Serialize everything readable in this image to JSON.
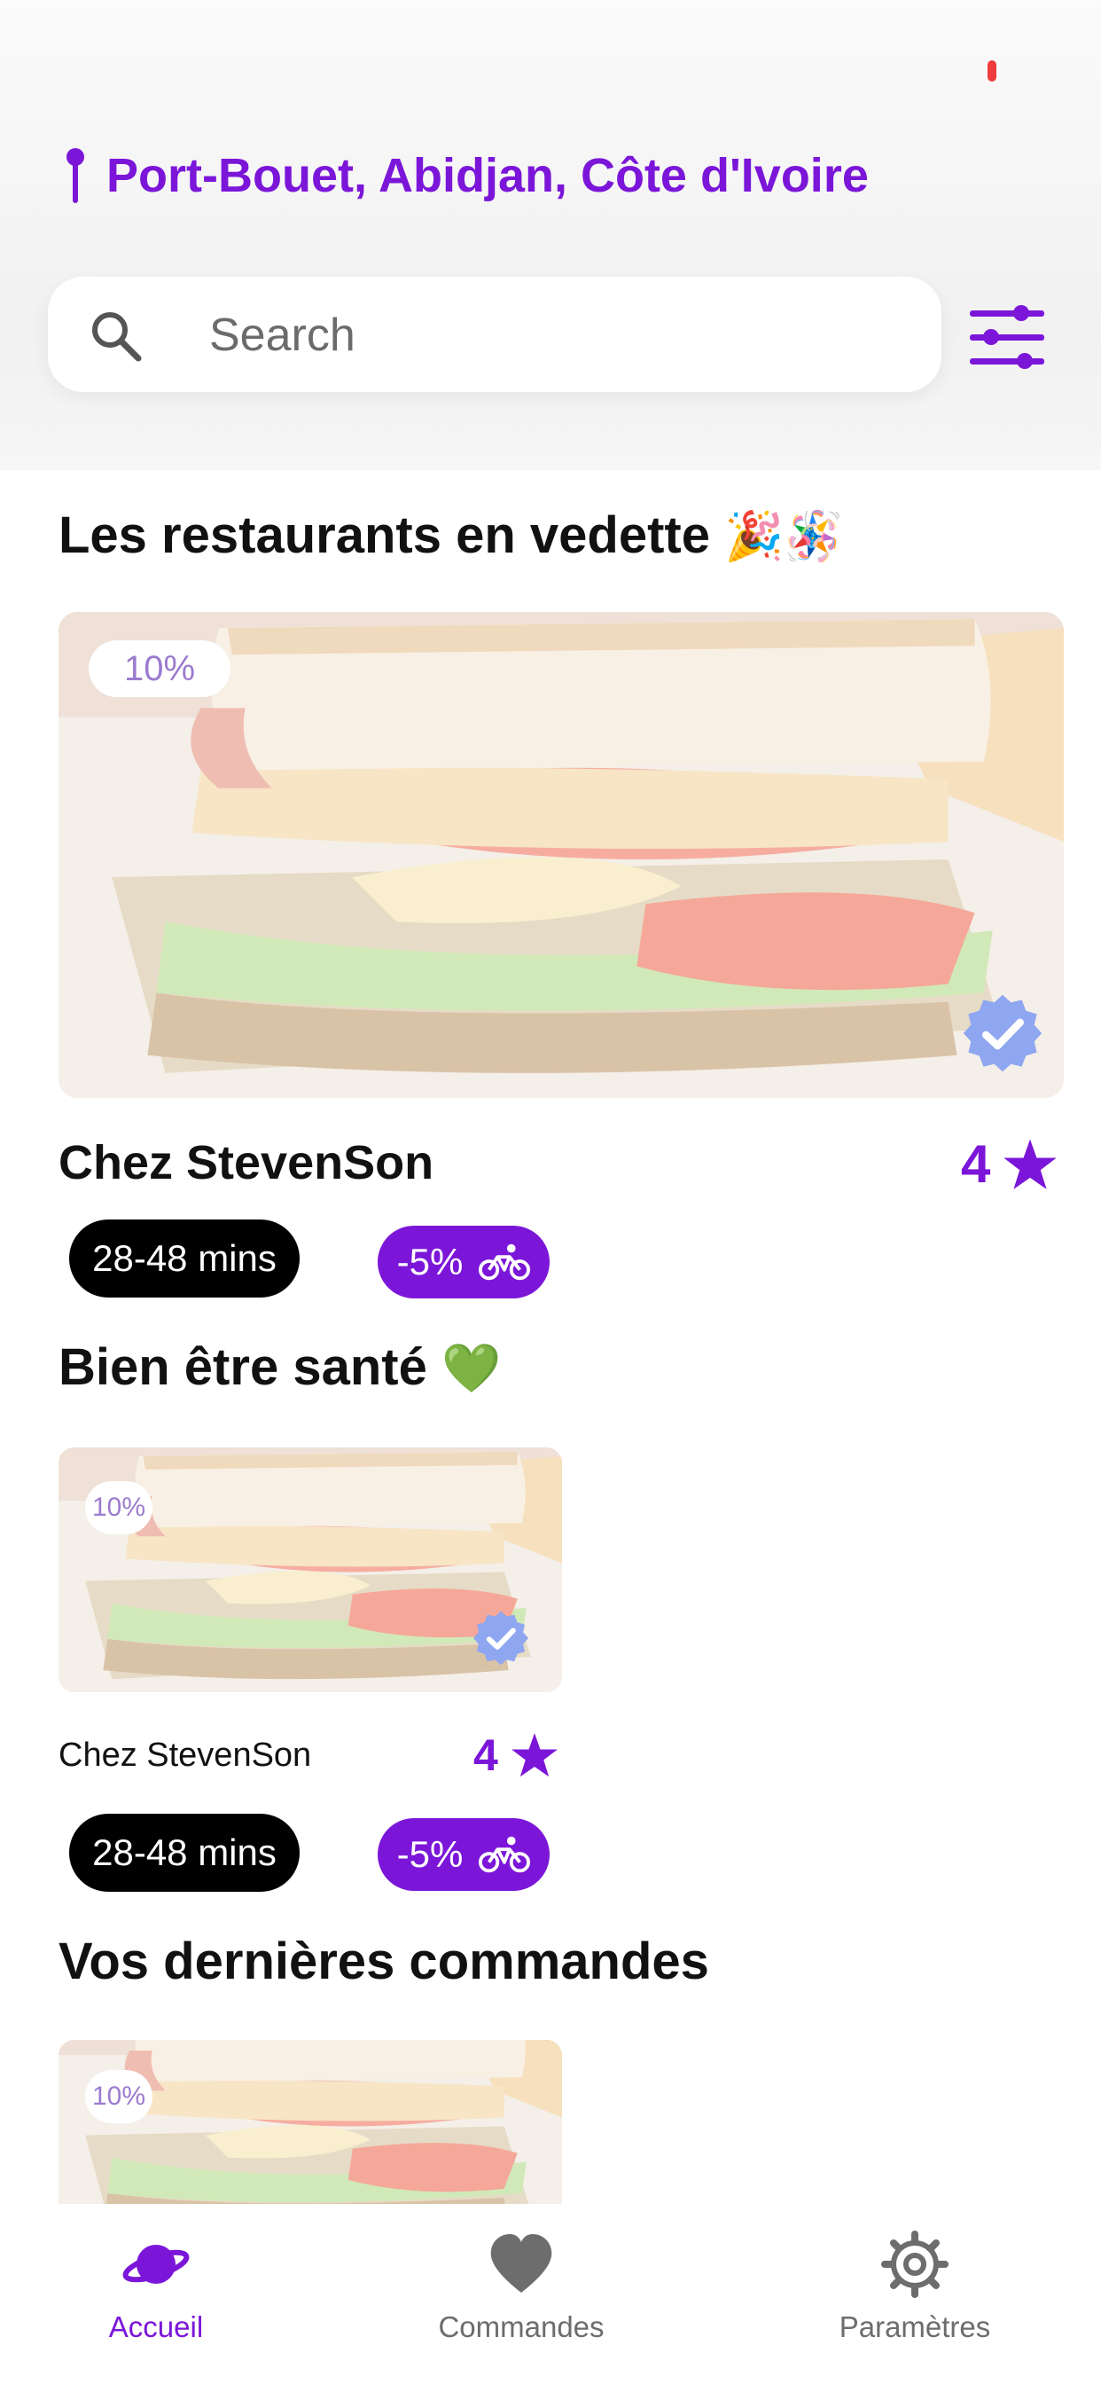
{
  "location": {
    "label": "Port-Bouet, Abidjan, Côte d'Ivoire"
  },
  "search": {
    "placeholder": "Search"
  },
  "sections": {
    "featured": {
      "title": "Les restaurants en vedette",
      "emoji": "🎉🪅"
    },
    "wellness": {
      "title": "Bien être santé",
      "emoji": "💚"
    },
    "recent": {
      "title": "Vos dernières commandes"
    }
  },
  "featured_card": {
    "discount_badge": "10%",
    "name": "Chez StevenSon",
    "rating": "4",
    "delivery_time": "28-48 mins",
    "delivery_discount": "-5%"
  },
  "wellness_card": {
    "discount_badge": "10%",
    "name": "Chez StevenSon",
    "rating": "4",
    "delivery_time": "28-48 mins",
    "delivery_discount": "-5%"
  },
  "recent_card": {
    "discount_badge": "10%"
  },
  "tabbar": {
    "home": "Accueil",
    "orders": "Commandes",
    "settings": "Paramètres"
  },
  "colors": {
    "accent": "#7b16d9",
    "inactive": "#6d6d6d"
  },
  "icons": [
    "pin-icon",
    "search-icon",
    "filter-icon",
    "verified-icon",
    "star-icon",
    "bike-icon",
    "planet-icon",
    "heart-icon",
    "gear-icon"
  ]
}
